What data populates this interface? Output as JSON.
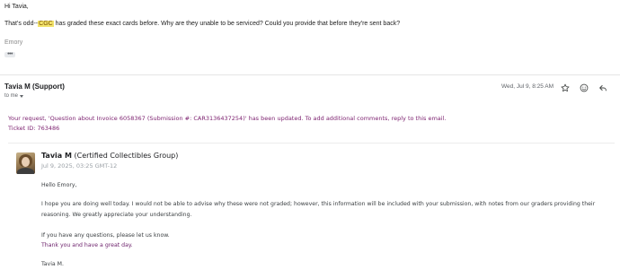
{
  "quoted": {
    "greeting": "Hi Tavia,",
    "line_before": "That's odd--",
    "highlight": "CGC",
    "line_after": " has graded these exact cards before. Why are they unable to be serviced? Could you provide that before they're sent back?",
    "signature": "Emory",
    "show_trimmed": "•••"
  },
  "message": {
    "sender": "Tavia M (Support)",
    "recipient": "to me",
    "datetime": "Wed, Jul 9, 8:25 AM",
    "icons": [
      "star-icon",
      "emoji-icon",
      "reply-icon"
    ],
    "notice_line1": "Your request, 'Question about Invoice 6058367 (Submission #: CAR3136437254)' has been updated. To add additional comments, reply to this email.",
    "notice_line2": "Ticket ID: 763486"
  },
  "reply": {
    "name": "Tavia M",
    "org": "(Certified Collectibles Group)",
    "date": "Jul 9, 2025, 03:25 GMT-12",
    "greeting": "Hello Emory,",
    "para1_line1": "I hope you are doing well today. I would not be able to advise why these were not graded; however, this information will be included with your submission, with notes from our graders providing their",
    "para1_line2": "reasoning. We greatly appreciate your understanding.",
    "questions": "If you have any questions, please let us know.",
    "thanks": "Thank you and have a great day.",
    "signoff": "Tavia M."
  },
  "colors": {
    "highlight": "#f2e36b",
    "notice": "#7b1f6e",
    "thanks": "#6b1f6a"
  }
}
